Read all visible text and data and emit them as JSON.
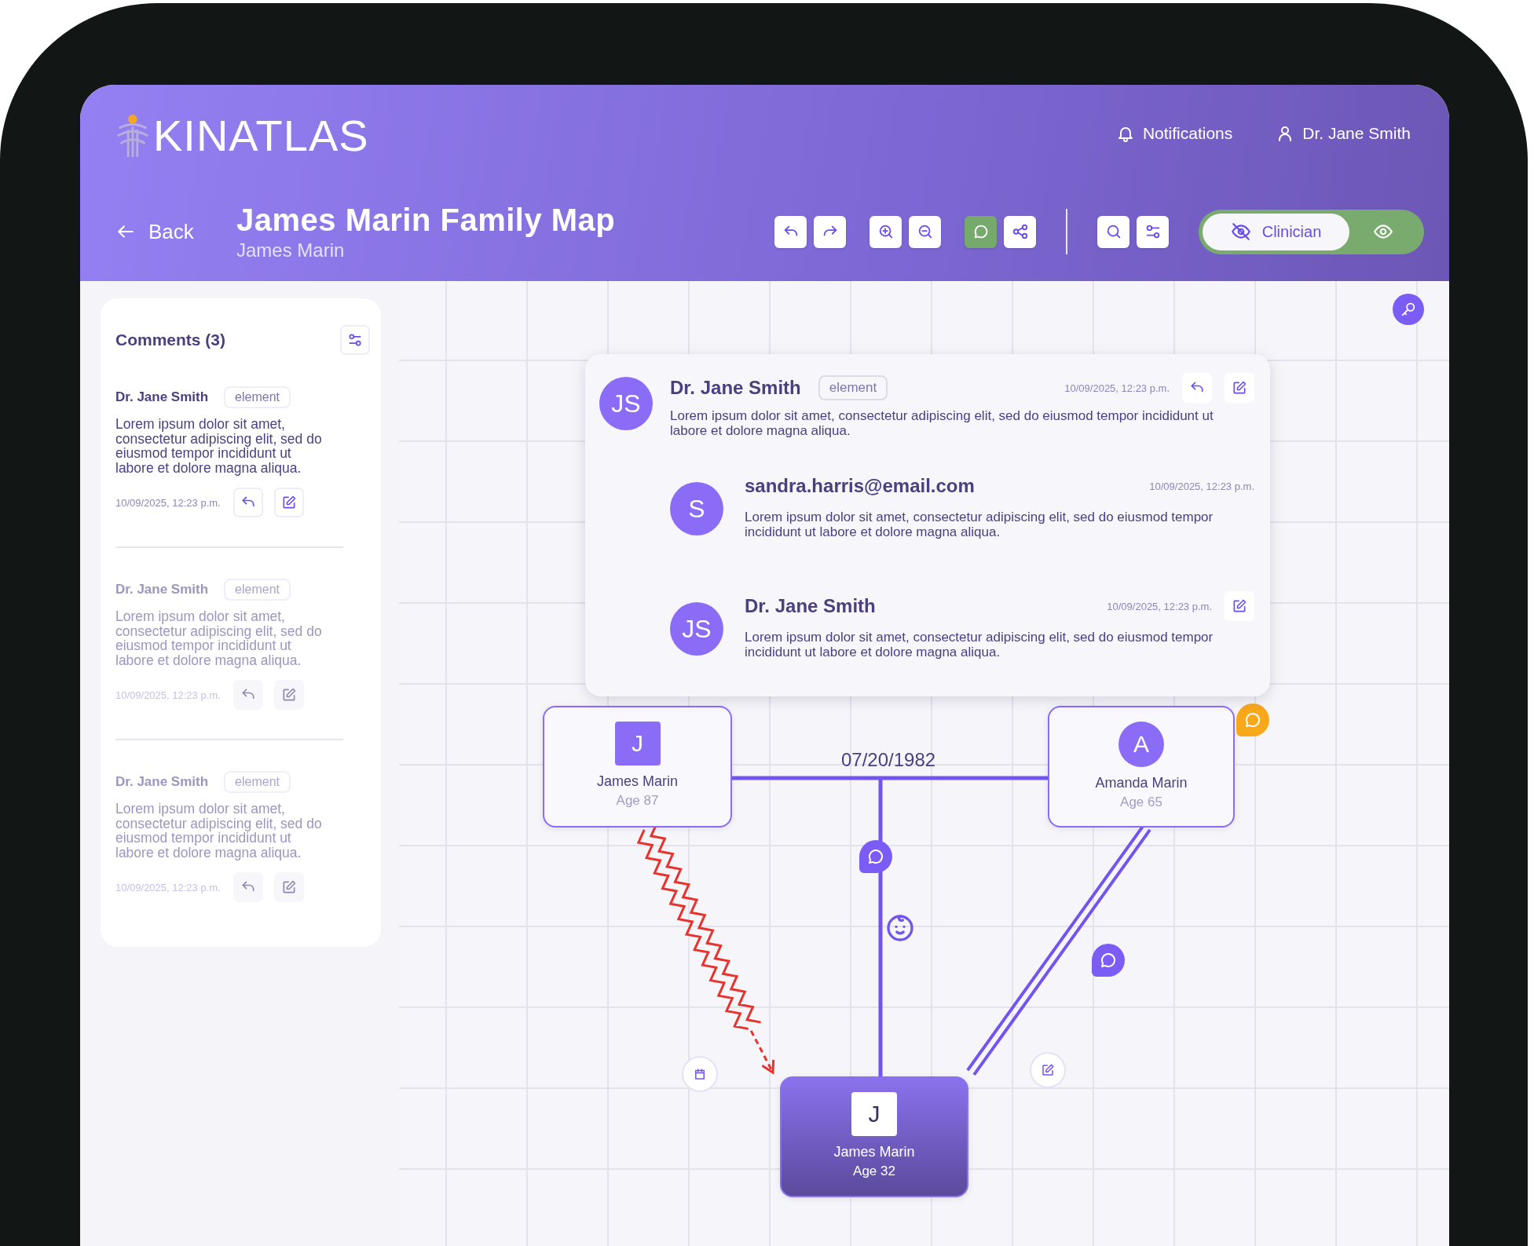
{
  "app": {
    "logo": "KINATLAS",
    "notifications": "Notifications",
    "user": "Dr. Jane Smith"
  },
  "page": {
    "back": "Back",
    "title": "James Marin Family Map",
    "subtitle": "James Marin"
  },
  "toolbar": [
    {
      "groups": [
        {
          "buttons": [
            {
              "kind": "undo",
              "selected": false
            },
            {
              "kind": "redo",
              "selected": false
            }
          ]
        },
        {
          "buttons": [
            {
              "kind": "zoom-in",
              "selected": false
            },
            {
              "kind": "zoom-out",
              "selected": false
            }
          ]
        },
        {
          "buttons": [
            {
              "kind": "comment",
              "selected": true
            },
            {
              "kind": "share",
              "selected": false
            }
          ]
        }
      ]
    },
    {
      "groups": [
        {
          "buttons": [
            {
              "kind": "search",
              "selected": false
            },
            {
              "kind": "filter",
              "selected": false
            }
          ]
        }
      ]
    }
  ],
  "view_toggle": {
    "label": "Clinician",
    "selected": true
  },
  "comments_panel": {
    "title": "Comments (3)",
    "items": [
      {
        "author": "Dr. Jane Smith",
        "tag": "element",
        "text": "Lorem ipsum dolor sit amet, consectetur adipiscing elit, sed do eiusmod tempor incididunt ut labore et dolore magna aliqua.",
        "date": "10/09/2025, 12:23 p.m.",
        "selected": true
      },
      {
        "author": "Dr. Jane Smith",
        "tag": "element",
        "text": "Lorem ipsum dolor sit amet, consectetur adipiscing elit, sed do eiusmod tempor incididunt ut labore et dolore magna aliqua.",
        "date": "10/09/2025, 12:23 p.m.",
        "selected": false
      },
      {
        "author": "Dr. Jane Smith",
        "tag": "element",
        "text": "Lorem ipsum dolor sit amet, consectetur adipiscing elit, sed do eiusmod tempor incididunt ut labore et dolore magna aliqua.",
        "date": "10/09/2025, 12:23 p.m.",
        "selected": false
      }
    ]
  },
  "thread": [
    {
      "kind": "comment",
      "initials": "JS",
      "author": "Dr. Jane Smith",
      "tag": "element",
      "date": "10/09/2025, 12:23 p.m.",
      "text": "Lorem ipsum dolor sit amet, consectetur adipiscing elit, sed do eiusmod tempor incididunt ut labore et dolore magna aliqua.",
      "reply_button": true,
      "edit_button": true
    },
    {
      "kind": "reply",
      "initials": "S",
      "author": "sandra.harris@email.com",
      "date": "10/09/2025, 12:23 p.m.",
      "text": "Lorem ipsum dolor sit amet, consectetur adipiscing elit, sed do eiusmod tempor incididunt ut labore et dolore magna aliqua.",
      "reply_button": false,
      "edit_button": false
    },
    {
      "kind": "reply",
      "initials": "JS",
      "author": "Dr. Jane Smith",
      "date": "10/09/2025, 12:23 p.m.",
      "text": "Lorem ipsum dolor sit amet, consectetur adipiscing elit, sed do eiusmod tempor incididunt ut labore et dolore magna aliqua.",
      "reply_button": false,
      "edit_button": true
    }
  ],
  "family_map": {
    "people": [
      {
        "kind": "square",
        "initial": "J",
        "name": "James Marin",
        "age": "Age 87",
        "selected": false
      },
      {
        "kind": "circle",
        "initial": "A",
        "name": "Amanda Marin",
        "age": "Age 65",
        "selected": false
      },
      {
        "kind": "square",
        "initial": "J",
        "name": "James Marin",
        "age": "Age 32",
        "selected": true
      }
    ],
    "marriage_date": "07/20/1982",
    "relations": [
      {
        "kind": "zigzag"
      },
      {
        "kind": "double"
      }
    ],
    "comment_markers": [
      {
        "color": "#7b5cf5"
      },
      {
        "color": "#7b5cf5"
      },
      {
        "color": "#f7a81b"
      }
    ]
  }
}
